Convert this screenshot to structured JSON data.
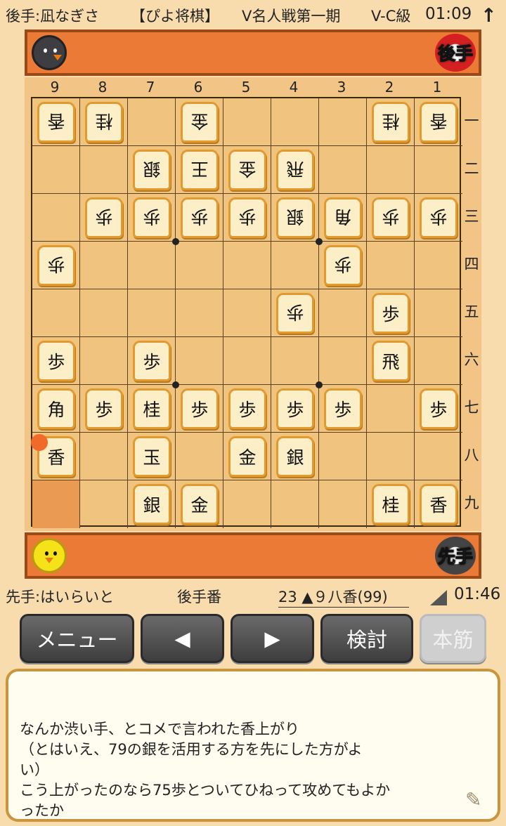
{
  "header": {
    "player": "後手:凪なぎさ",
    "app": "【ぴよ将棋】",
    "event": "V名人戦第一期",
    "rank": "V-C級",
    "time": "01:09",
    "arrow_icon": "↑"
  },
  "top_hand": {
    "badge": "後手",
    "avatar": "black-chick-avatar"
  },
  "bottom_hand": {
    "badge": "先手",
    "avatar": "yellow-chick-avatar"
  },
  "board": {
    "files": [
      "9",
      "8",
      "7",
      "6",
      "5",
      "4",
      "3",
      "2",
      "1"
    ],
    "ranks": [
      "一",
      "二",
      "三",
      "四",
      "五",
      "六",
      "七",
      "八",
      "九"
    ],
    "highlight": {
      "file": 9,
      "rank": 9
    },
    "last_move": {
      "file": 9,
      "rank": 8
    },
    "pieces": [
      {
        "file": 9,
        "rank": 1,
        "label": "香",
        "side": "gote"
      },
      {
        "file": 8,
        "rank": 1,
        "label": "桂",
        "side": "gote"
      },
      {
        "file": 6,
        "rank": 1,
        "label": "金",
        "side": "gote"
      },
      {
        "file": 2,
        "rank": 1,
        "label": "桂",
        "side": "gote"
      },
      {
        "file": 1,
        "rank": 1,
        "label": "香",
        "side": "gote"
      },
      {
        "file": 7,
        "rank": 2,
        "label": "銀",
        "side": "gote"
      },
      {
        "file": 6,
        "rank": 2,
        "label": "王",
        "side": "gote"
      },
      {
        "file": 5,
        "rank": 2,
        "label": "金",
        "side": "gote"
      },
      {
        "file": 4,
        "rank": 2,
        "label": "飛",
        "side": "gote"
      },
      {
        "file": 8,
        "rank": 3,
        "label": "歩",
        "side": "gote"
      },
      {
        "file": 7,
        "rank": 3,
        "label": "歩",
        "side": "gote"
      },
      {
        "file": 6,
        "rank": 3,
        "label": "歩",
        "side": "gote"
      },
      {
        "file": 5,
        "rank": 3,
        "label": "歩",
        "side": "gote"
      },
      {
        "file": 4,
        "rank": 3,
        "label": "銀",
        "side": "gote"
      },
      {
        "file": 3,
        "rank": 3,
        "label": "角",
        "side": "gote"
      },
      {
        "file": 2,
        "rank": 3,
        "label": "歩",
        "side": "gote"
      },
      {
        "file": 1,
        "rank": 3,
        "label": "歩",
        "side": "gote"
      },
      {
        "file": 9,
        "rank": 4,
        "label": "歩",
        "side": "gote"
      },
      {
        "file": 3,
        "rank": 4,
        "label": "歩",
        "side": "gote"
      },
      {
        "file": 4,
        "rank": 5,
        "label": "歩",
        "side": "gote"
      },
      {
        "file": 2,
        "rank": 5,
        "label": "歩",
        "side": "sente"
      },
      {
        "file": 9,
        "rank": 6,
        "label": "歩",
        "side": "sente"
      },
      {
        "file": 7,
        "rank": 6,
        "label": "歩",
        "side": "sente"
      },
      {
        "file": 2,
        "rank": 6,
        "label": "飛",
        "side": "sente"
      },
      {
        "file": 9,
        "rank": 7,
        "label": "角",
        "side": "sente"
      },
      {
        "file": 8,
        "rank": 7,
        "label": "歩",
        "side": "sente"
      },
      {
        "file": 7,
        "rank": 7,
        "label": "桂",
        "side": "sente"
      },
      {
        "file": 6,
        "rank": 7,
        "label": "歩",
        "side": "sente"
      },
      {
        "file": 5,
        "rank": 7,
        "label": "歩",
        "side": "sente"
      },
      {
        "file": 4,
        "rank": 7,
        "label": "歩",
        "side": "sente"
      },
      {
        "file": 3,
        "rank": 7,
        "label": "歩",
        "side": "sente"
      },
      {
        "file": 1,
        "rank": 7,
        "label": "歩",
        "side": "sente"
      },
      {
        "file": 9,
        "rank": 8,
        "label": "香",
        "side": "sente"
      },
      {
        "file": 7,
        "rank": 8,
        "label": "玉",
        "side": "sente"
      },
      {
        "file": 5,
        "rank": 8,
        "label": "金",
        "side": "sente"
      },
      {
        "file": 4,
        "rank": 8,
        "label": "銀",
        "side": "sente"
      },
      {
        "file": 7,
        "rank": 9,
        "label": "銀",
        "side": "sente"
      },
      {
        "file": 6,
        "rank": 9,
        "label": "金",
        "side": "sente"
      },
      {
        "file": 2,
        "rank": 9,
        "label": "桂",
        "side": "sente"
      },
      {
        "file": 1,
        "rank": 9,
        "label": "香",
        "side": "sente"
      }
    ]
  },
  "info": {
    "sente_player": "先手:はいらいと",
    "turn": "後手番",
    "move": "23 ▲９八香(99)",
    "time": "01:46"
  },
  "buttons": {
    "menu": "メニュー",
    "prev": "◀",
    "next": "▶",
    "review": "検討",
    "main_line": "本筋"
  },
  "comment": "なんか渋い手、とコメで言われた香上がり\n（とはいえ、79の銀を活用する方を先にした方がよ\nい）\nこう上がったのなら75歩とついてひねって攻めてもよか\nったか"
}
